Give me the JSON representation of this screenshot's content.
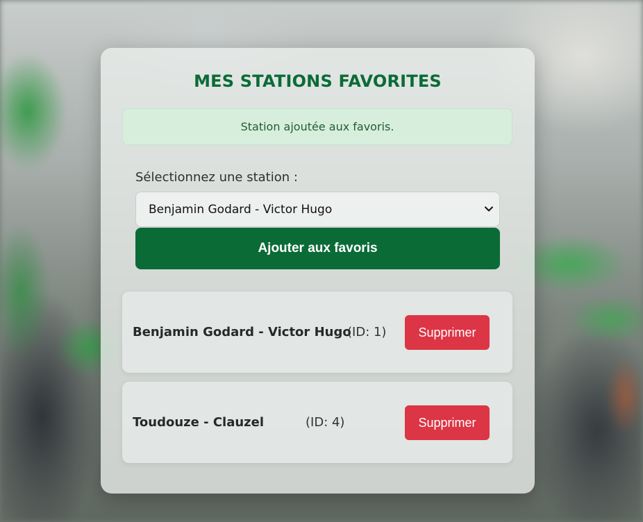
{
  "page": {
    "title": "MES STATIONS FAVORITES"
  },
  "alert": {
    "message": "Station ajoutée aux favoris."
  },
  "form": {
    "select_label": "Sélectionnez une station :",
    "selected_station": "Benjamin Godard - Victor Hugo",
    "add_button_label": "Ajouter aux favoris"
  },
  "favorites": [
    {
      "name": "Benjamin Godard - Victor Hugo",
      "id_text": "(ID: 1)",
      "delete_label": "Supprimer"
    },
    {
      "name": "Toudouze - Clauzel",
      "id_text": "(ID: 4)",
      "delete_label": "Supprimer"
    }
  ],
  "colors": {
    "brand_green": "#0b6b37",
    "delete_red": "#dc3545",
    "alert_bg": "#d6eedc"
  },
  "icons": {
    "select_arrow": "chevron-down-icon"
  }
}
